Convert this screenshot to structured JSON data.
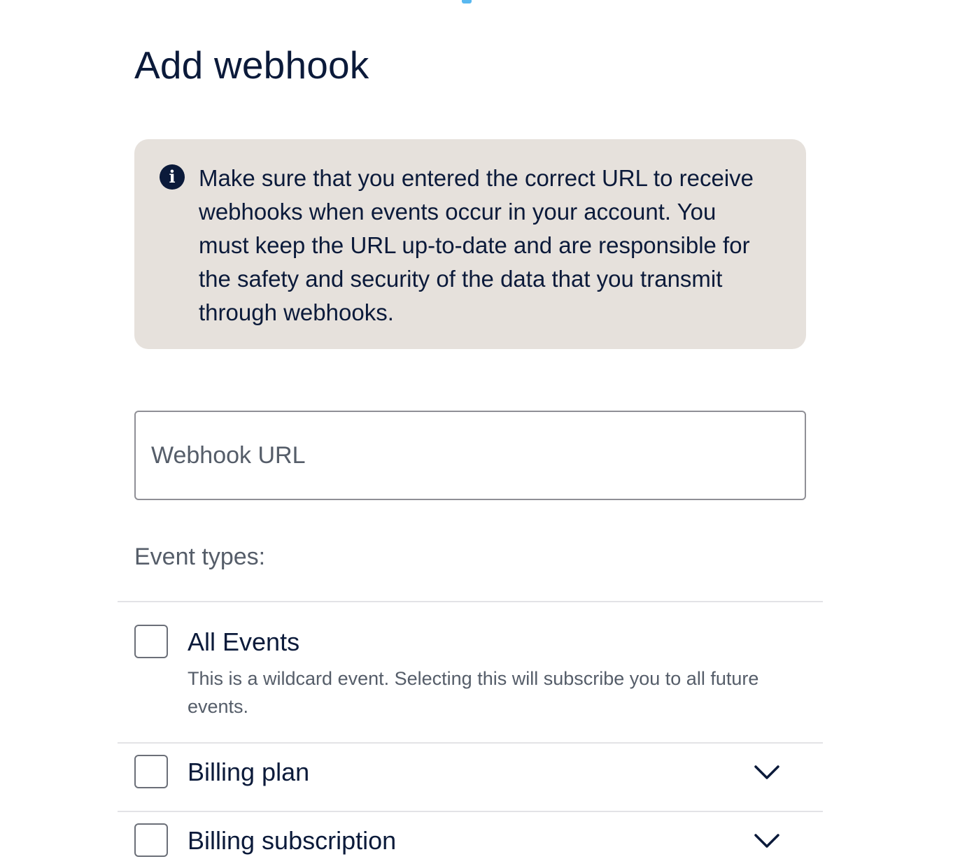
{
  "page": {
    "title": "Add webhook"
  },
  "banner": {
    "icon": "info-icon",
    "icon_glyph": "i",
    "text": "Make sure that you entered the correct URL to receive webhooks when events occur in your account. You must keep the URL up-to-date and are responsible for the safety and security of the data that you transmit through webhooks.",
    "background_color": "#e6e1dc"
  },
  "form": {
    "url_input": {
      "placeholder": "Webhook URL",
      "value": ""
    },
    "event_types_label": "Event types:"
  },
  "events": [
    {
      "label": "All Events",
      "description": "This is a wildcard event. Selecting this will subscribe you to all future events.",
      "checked": false,
      "expandable": false
    },
    {
      "label": "Billing plan",
      "checked": false,
      "expandable": true,
      "icon": "chevron-down-icon"
    },
    {
      "label": "Billing subscription",
      "checked": false,
      "expandable": true,
      "icon": "chevron-down-icon"
    }
  ],
  "colors": {
    "text_primary": "#0b1a3a",
    "text_secondary": "#555d69",
    "accent": "#59b8f0"
  }
}
